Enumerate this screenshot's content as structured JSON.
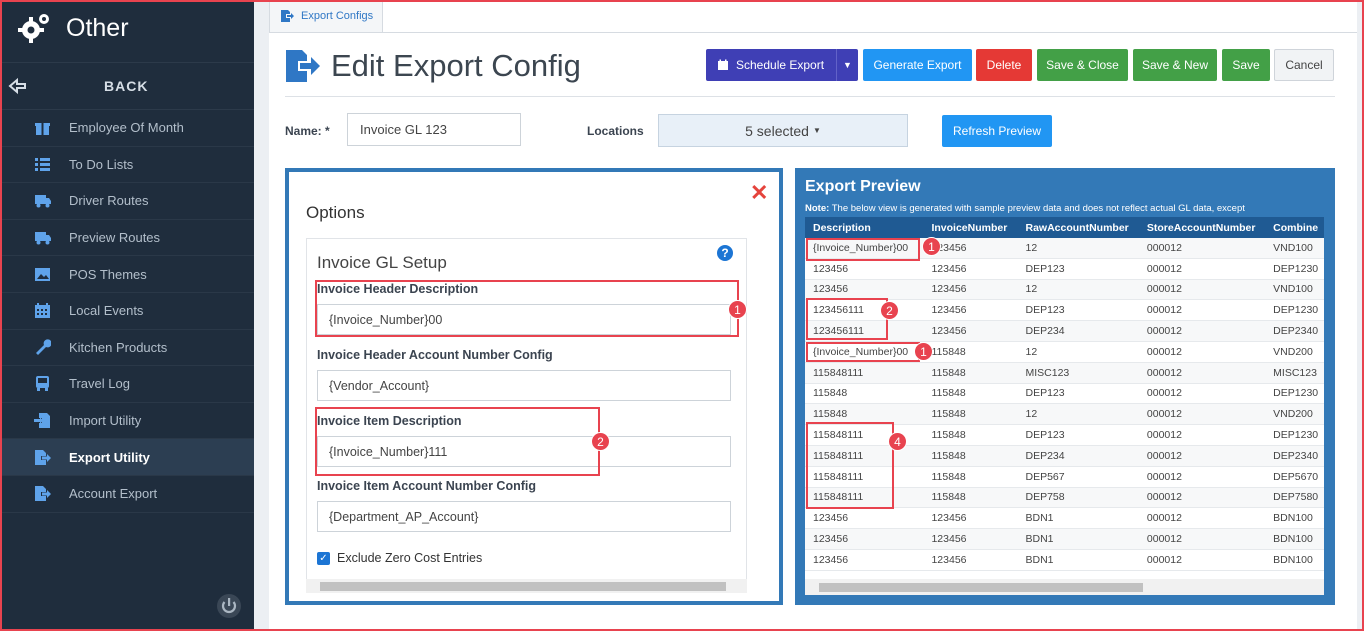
{
  "sidebar": {
    "title": "Other",
    "back_label": "BACK",
    "items": [
      {
        "label": "Employee Of Month",
        "icon": "gift-icon"
      },
      {
        "label": "To Do Lists",
        "icon": "list-icon"
      },
      {
        "label": "Driver Routes",
        "icon": "truck-icon"
      },
      {
        "label": "Preview Routes",
        "icon": "truck-icon"
      },
      {
        "label": "POS Themes",
        "icon": "image-icon"
      },
      {
        "label": "Local Events",
        "icon": "calendar-icon"
      },
      {
        "label": "Kitchen Products",
        "icon": "wrench-icon"
      },
      {
        "label": "Travel Log",
        "icon": "bus-icon"
      },
      {
        "label": "Import Utility",
        "icon": "import-icon"
      },
      {
        "label": "Export Utility",
        "icon": "export-icon",
        "active": true
      },
      {
        "label": "Account Export",
        "icon": "export-icon"
      }
    ]
  },
  "tab": {
    "label": "Export Configs"
  },
  "page": {
    "title": "Edit Export Config"
  },
  "toolbar": {
    "schedule_export": "Schedule Export",
    "generate_export": "Generate Export",
    "delete": "Delete",
    "save_close": "Save & Close",
    "save_new": "Save & New",
    "save": "Save",
    "cancel": "Cancel"
  },
  "form": {
    "name_label": "Name: *",
    "name_value": "Invoice GL 123",
    "locations_label": "Locations",
    "locations_value": "5 selected",
    "refresh_preview": "Refresh Preview"
  },
  "options": {
    "title": "Options",
    "close": "✕",
    "section_title": "Invoice GL Setup",
    "fields": [
      {
        "label": "Invoice Header Description",
        "value": "{Invoice_Number}00"
      },
      {
        "label": "Invoice Header Account Number Config",
        "value": "{Vendor_Account}"
      },
      {
        "label": "Invoice Item Description",
        "value": "{Invoice_Number}111"
      },
      {
        "label": "Invoice Item Account Number Config",
        "value": "{Department_AP_Account}"
      }
    ],
    "checkbox_label": "Exclude Zero Cost Entries",
    "checkbox_checked": true
  },
  "preview": {
    "title": "Export Preview",
    "note_bold": "Note:",
    "note": " The below view is generated with sample preview data and does not reflect actual GL data, except",
    "columns": [
      "Description",
      "InvoiceNumber",
      "RawAccountNumber",
      "StoreAccountNumber",
      "Combine"
    ],
    "rows": [
      [
        "{Invoice_Number}00",
        "123456",
        "12",
        "000012",
        "VND100"
      ],
      [
        "123456",
        "123456",
        "DEP123",
        "000012",
        "DEP1230"
      ],
      [
        "123456",
        "123456",
        "12",
        "000012",
        "VND100"
      ],
      [
        "123456111",
        "123456",
        "DEP123",
        "000012",
        "DEP1230"
      ],
      [
        "123456111",
        "123456",
        "DEP234",
        "000012",
        "DEP2340"
      ],
      [
        "{Invoice_Number}00",
        "115848",
        "12",
        "000012",
        "VND200"
      ],
      [
        "115848111",
        "115848",
        "MISC123",
        "000012",
        "MISC123"
      ],
      [
        "115848",
        "115848",
        "DEP123",
        "000012",
        "DEP1230"
      ],
      [
        "115848",
        "115848",
        "12",
        "000012",
        "VND200"
      ],
      [
        "115848111",
        "115848",
        "DEP123",
        "000012",
        "DEP1230"
      ],
      [
        "115848111",
        "115848",
        "DEP234",
        "000012",
        "DEP2340"
      ],
      [
        "115848111",
        "115848",
        "DEP567",
        "000012",
        "DEP5670"
      ],
      [
        "115848111",
        "115848",
        "DEP758",
        "000012",
        "DEP7580"
      ],
      [
        "123456",
        "123456",
        "BDN1",
        "000012",
        "BDN100"
      ],
      [
        "123456",
        "123456",
        "BDN1",
        "000012",
        "BDN100"
      ],
      [
        "123456",
        "123456",
        "BDN1",
        "000012",
        "BDN100"
      ]
    ]
  },
  "annotations": {
    "badge_1": "1",
    "badge_2": "2",
    "badge_4": "4"
  },
  "colors": {
    "sidebar_bg": "#1f2d3d",
    "panel_blue": "#3379b7",
    "schedule_btn": "#3f3fb5",
    "generate_btn": "#2196f3",
    "delete_btn": "#e53935",
    "save_btn": "#43a047",
    "annotation_red": "#e8434f"
  }
}
